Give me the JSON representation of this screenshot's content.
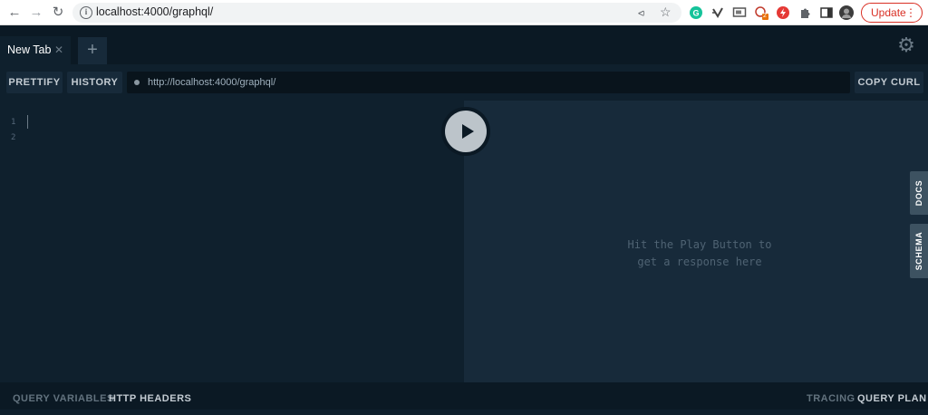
{
  "browser": {
    "url": "localhost:4000/graphql/",
    "update_label": "Update",
    "extension_badge": "2"
  },
  "tabs": [
    {
      "label": "New Tab"
    }
  ],
  "toolbar": {
    "prettify_label": "PRETTIFY",
    "history_label": "HISTORY",
    "endpoint_url": "http://localhost:4000/graphql/",
    "copy_curl_label": "COPY CURL"
  },
  "editor": {
    "line_numbers": [
      "1",
      "2"
    ]
  },
  "result": {
    "placeholder": "Hit the Play Button to\nget a response here"
  },
  "side_tabs": {
    "docs_label": "DOCS",
    "schema_label": "SCHEMA"
  },
  "bottom": {
    "query_variables_label": "QUERY VARIABLES",
    "http_headers_label": "HTTP HEADERS",
    "tracing_label": "TRACING",
    "query_plan_label": "QUERY PLAN"
  },
  "colors": {
    "editor_bg": "#0f202d",
    "result_bg": "#172a3a",
    "bar_bg": "#0b1924",
    "update_red": "#d93025"
  }
}
